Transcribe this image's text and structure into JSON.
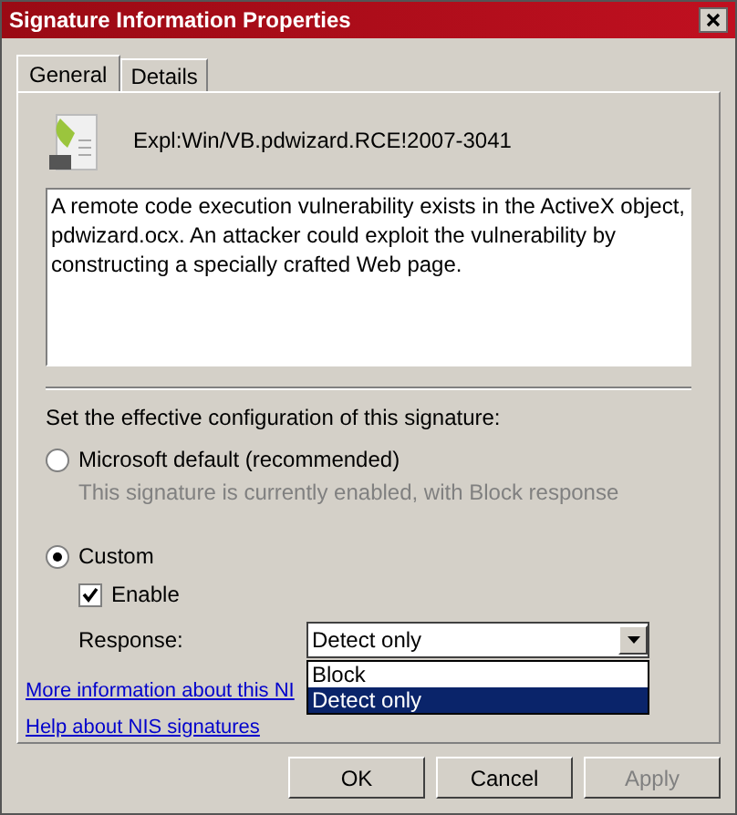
{
  "window": {
    "title": "Signature Information Properties"
  },
  "tabs": [
    {
      "label": "General",
      "selected": true
    },
    {
      "label": "Details",
      "selected": false
    }
  ],
  "signature": {
    "name": "Expl:Win/VB.pdwizard.RCE!2007-3041",
    "description": "A remote code execution vulnerability exists in the ActiveX object, pdwizard.ocx. An attacker could exploit the vulnerability by constructing a specially crafted Web page."
  },
  "config": {
    "heading": "Set the effective configuration of this signature:",
    "options": [
      {
        "label": "Microsoft default (recommended)",
        "selected": false,
        "note": "This signature is currently enabled, with Block response"
      },
      {
        "label": "Custom",
        "selected": true
      }
    ],
    "enable": {
      "label": "Enable",
      "checked": true
    },
    "response": {
      "label": "Response:",
      "value": "Detect only",
      "expanded": true,
      "options": [
        {
          "label": "Block",
          "selected": false
        },
        {
          "label": "Detect only",
          "selected": true
        }
      ]
    }
  },
  "links": [
    "More information about this NI",
    "Help about NIS signatures"
  ],
  "buttons": [
    {
      "label": "OK",
      "disabled": false
    },
    {
      "label": "Cancel",
      "disabled": false
    },
    {
      "label": "Apply",
      "disabled": true
    }
  ]
}
